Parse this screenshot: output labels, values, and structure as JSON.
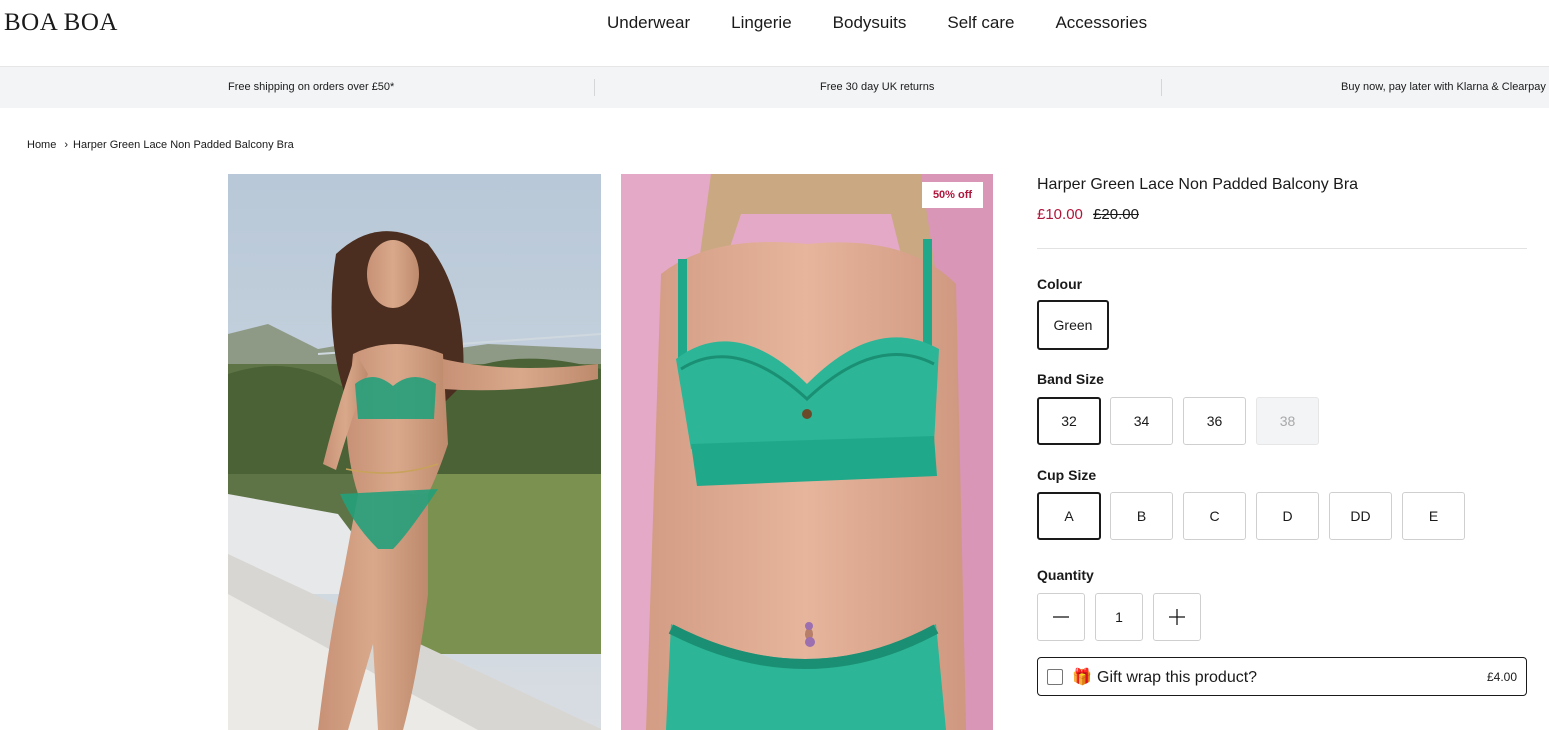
{
  "header": {
    "logo": "BOA BOA",
    "nav": [
      "Underwear",
      "Lingerie",
      "Bodysuits",
      "Self care",
      "Accessories"
    ]
  },
  "usp": [
    "Free shipping on orders over £50*",
    "Free 30 day UK returns",
    "Buy now, pay later with Klarna & Clearpay"
  ],
  "breadcrumb": {
    "home": "Home",
    "separator": "›",
    "current": "Harper Green Lace Non Padded Balcony Bra"
  },
  "gallery": {
    "badge": "50% off"
  },
  "product": {
    "title": "Harper Green Lace Non Padded Balcony Bra",
    "price": "£10.00",
    "compare_price": "£20.00",
    "colour": {
      "label": "Colour",
      "options": [
        "Green"
      ],
      "selected": "Green"
    },
    "band": {
      "label": "Band Size",
      "options": [
        "32",
        "34",
        "36",
        "38"
      ],
      "selected": "32",
      "unavailable": [
        "38"
      ]
    },
    "cup": {
      "label": "Cup Size",
      "options": [
        "A",
        "B",
        "C",
        "D",
        "DD",
        "E"
      ],
      "selected": "A"
    },
    "quantity": {
      "label": "Quantity",
      "value": "1"
    },
    "gift": {
      "emoji": "🎁",
      "label": "Gift wrap this product?",
      "price": "£4.00"
    }
  },
  "colors": {
    "sale": "#b0163c",
    "usp_bg": "#f3f4f6",
    "text": "#1a1a1a"
  }
}
